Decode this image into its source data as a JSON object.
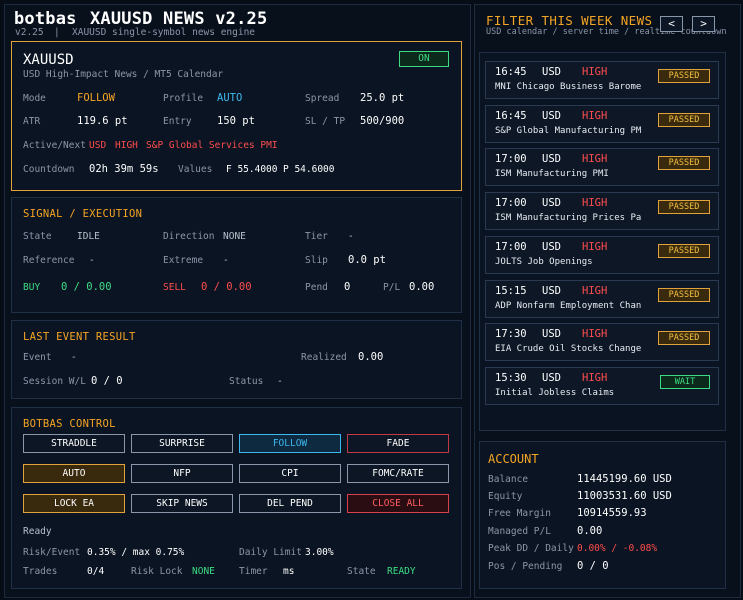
{
  "header": {
    "brand": "botbas",
    "title": "XAUUSD NEWS v2.25",
    "version": "v2.25",
    "separator": "|",
    "subtitle": "XAUUSD single-symbol news engine"
  },
  "symbol_panel": {
    "symbol": "XAUUSD",
    "caption": "USD High-Impact News / MT5 Calendar",
    "toggle": "ON",
    "mode_label": "Mode",
    "mode_value": "FOLLOW",
    "profile_label": "Profile",
    "profile_value": "AUTO",
    "spread_label": "Spread",
    "spread_value": "25.0 pt",
    "atr_label": "ATR",
    "atr_value": "119.6 pt",
    "entry_label": "Entry",
    "entry_value": "150 pt",
    "sltp_label": "SL / TP",
    "sltp_value": "500/900",
    "active_label": "Active/Next",
    "active_currency": "USD",
    "active_impact": "HIGH",
    "active_event": "S&P Global Services PMI",
    "countdown_label": "Countdown",
    "countdown_value": "02h 39m 59s",
    "values_label": "Values",
    "values_f": "F 55.4000",
    "values_p": "P 54.6000"
  },
  "signal": {
    "title": "SIGNAL / EXECUTION",
    "state_label": "State",
    "state_value": "IDLE",
    "direction_label": "Direction",
    "direction_value": "NONE",
    "tier_label": "Tier",
    "tier_value": "-",
    "reference_label": "Reference",
    "reference_value": "-",
    "extreme_label": "Extreme",
    "extreme_value": "-",
    "slip_label": "Slip",
    "slip_value": "0.0 pt",
    "buy_label": "BUY",
    "buy_value": "0 / 0.00",
    "sell_label": "SELL",
    "sell_value": "0 / 0.00",
    "pend_label": "Pend",
    "pend_value": "0",
    "pl_label": "P/L",
    "pl_value": "0.00"
  },
  "last_event": {
    "title": "LAST EVENT RESULT",
    "event_label": "Event",
    "event_value": "-",
    "realized_label": "Realized",
    "realized_value": "0.00",
    "session_label": "Session W/L",
    "session_value": "0 / 0",
    "status_label": "Status",
    "status_value": "-"
  },
  "control": {
    "title": "BOTBAS CONTROL",
    "buttons": {
      "straddle": "STRADDLE",
      "surprise": "SURPRISE",
      "follow": "FOLLOW",
      "fade": "FADE",
      "auto": "AUTO",
      "nfp": "NFP",
      "cpi": "CPI",
      "fomc": "FOMC/RATE",
      "lock": "LOCK EA",
      "skip": "SKIP NEWS",
      "delpend": "DEL PEND",
      "closeall": "CLOSE ALL"
    },
    "ready": "Ready",
    "risk_label": "Risk/Event",
    "risk_value": "0.35% / max 0.75%",
    "daily_label": "Daily Limit",
    "daily_value": "3.00%",
    "trades_label": "Trades",
    "trades_value": "0/4",
    "risklock_label": "Risk Lock",
    "risklock_value": "NONE",
    "timer_label": "Timer",
    "timer_value": "ms",
    "state_label": "State",
    "state_value": "READY"
  },
  "filter": {
    "title": "FILTER THIS WEEK NEWS",
    "subtitle": "USD calendar / server time / realtime countdown",
    "prev": "<",
    "next": ">",
    "items": [
      {
        "time": "16:45",
        "currency": "USD",
        "impact": "HIGH",
        "name": "MNI Chicago Business Barome",
        "status": "PASSED"
      },
      {
        "time": "16:45",
        "currency": "USD",
        "impact": "HIGH",
        "name": "S&P Global Manufacturing PM",
        "status": "PASSED"
      },
      {
        "time": "17:00",
        "currency": "USD",
        "impact": "HIGH",
        "name": "ISM Manufacturing PMI",
        "status": "PASSED"
      },
      {
        "time": "17:00",
        "currency": "USD",
        "impact": "HIGH",
        "name": "ISM Manufacturing Prices Pa",
        "status": "PASSED"
      },
      {
        "time": "17:00",
        "currency": "USD",
        "impact": "HIGH",
        "name": "JOLTS Job Openings",
        "status": "PASSED"
      },
      {
        "time": "15:15",
        "currency": "USD",
        "impact": "HIGH",
        "name": "ADP Nonfarm Employment Chan",
        "status": "PASSED"
      },
      {
        "time": "17:30",
        "currency": "USD",
        "impact": "HIGH",
        "name": "EIA Crude Oil Stocks Change",
        "status": "PASSED"
      },
      {
        "time": "15:30",
        "currency": "USD",
        "impact": "HIGH",
        "name": "Initial Jobless Claims",
        "status": "WAIT"
      }
    ]
  },
  "account": {
    "title": "ACCOUNT",
    "balance_label": "Balance",
    "balance_value": "11445199.60 USD",
    "equity_label": "Equity",
    "equity_value": "11003531.60 USD",
    "freemargin_label": "Free Margin",
    "freemargin_value": "10914559.93",
    "managed_label": "Managed P/L",
    "managed_value": "0.00",
    "peak_label": "Peak DD / Daily",
    "peak_value": "0.00% / -0.08%",
    "pos_label": "Pos / Pending",
    "pos_value": "0 / 0"
  }
}
